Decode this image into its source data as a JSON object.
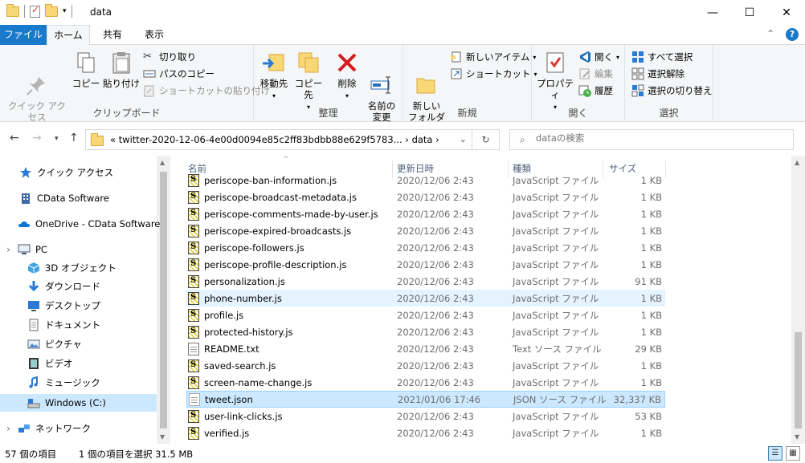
{
  "window": {
    "title": "data",
    "controls": [
      "—",
      "☐",
      "✕"
    ]
  },
  "tabs": {
    "file": "ファイル",
    "home": "ホーム",
    "share": "共有",
    "view": "表示"
  },
  "ribbon": {
    "clipboard": {
      "label": "クリップボード",
      "pin": "クイック アクセス\nにピン留めする",
      "copy": "コピー",
      "paste": "貼り付け",
      "cut": "切り取り",
      "copy_path": "パスのコピー",
      "paste_shortcut": "ショートカットの貼り付け"
    },
    "organize": {
      "label": "整理",
      "move_to": "移動先",
      "copy_to": "コピー先",
      "delete": "削除",
      "rename": "名前の\n変更"
    },
    "new": {
      "label": "新規",
      "new_folder": "新しい\nフォルダー",
      "new_item": "新しいアイテム",
      "shortcut": "ショートカット"
    },
    "open": {
      "label": "開く",
      "properties": "プロパティ",
      "open": "開く",
      "edit": "編集",
      "history": "履歴"
    },
    "select": {
      "label": "選択",
      "select_all": "すべて選択",
      "select_none": "選択解除",
      "invert": "選択の切り替え"
    }
  },
  "address": {
    "path": "«  twitter-2020-12-06-4e00d0094e85c2ff83bdbb88e629f5783...  ›  data  ›",
    "search_placeholder": "dataの検索"
  },
  "nav": {
    "items": [
      {
        "label": "クイック アクセス",
        "icon": "star-icon"
      },
      {
        "label": "CData Software",
        "icon": "building-icon"
      },
      {
        "label": "OneDrive - CData Software",
        "icon": "cloud-icon"
      },
      {
        "label": "PC",
        "icon": "pc-icon"
      },
      {
        "label": "3D オブジェクト",
        "icon": "cube-icon"
      },
      {
        "label": "ダウンロード",
        "icon": "download-icon"
      },
      {
        "label": "デスクトップ",
        "icon": "desktop-icon"
      },
      {
        "label": "ドキュメント",
        "icon": "document-icon"
      },
      {
        "label": "ピクチャ",
        "icon": "picture-icon"
      },
      {
        "label": "ビデオ",
        "icon": "video-icon"
      },
      {
        "label": "ミュージック",
        "icon": "music-icon"
      },
      {
        "label": "Windows (C:)",
        "icon": "drive-icon"
      },
      {
        "label": "ネットワーク",
        "icon": "network-icon"
      }
    ]
  },
  "columns": {
    "name": "名前",
    "date": "更新日時",
    "type": "種類",
    "size": "サイズ"
  },
  "files": [
    {
      "name": "periscope-ban-information.js",
      "date": "2020/12/06 2:43",
      "type": "JavaScript ファイル",
      "size": "1 KB",
      "kind": "js"
    },
    {
      "name": "periscope-broadcast-metadata.js",
      "date": "2020/12/06 2:43",
      "type": "JavaScript ファイル",
      "size": "1 KB",
      "kind": "js"
    },
    {
      "name": "periscope-comments-made-by-user.js",
      "date": "2020/12/06 2:43",
      "type": "JavaScript ファイル",
      "size": "1 KB",
      "kind": "js"
    },
    {
      "name": "periscope-expired-broadcasts.js",
      "date": "2020/12/06 2:43",
      "type": "JavaScript ファイル",
      "size": "1 KB",
      "kind": "js"
    },
    {
      "name": "periscope-followers.js",
      "date": "2020/12/06 2:43",
      "type": "JavaScript ファイル",
      "size": "1 KB",
      "kind": "js"
    },
    {
      "name": "periscope-profile-description.js",
      "date": "2020/12/06 2:43",
      "type": "JavaScript ファイル",
      "size": "1 KB",
      "kind": "js"
    },
    {
      "name": "personalization.js",
      "date": "2020/12/06 2:43",
      "type": "JavaScript ファイル",
      "size": "91 KB",
      "kind": "js"
    },
    {
      "name": "phone-number.js",
      "date": "2020/12/06 2:43",
      "type": "JavaScript ファイル",
      "size": "1 KB",
      "kind": "js"
    },
    {
      "name": "profile.js",
      "date": "2020/12/06 2:43",
      "type": "JavaScript ファイル",
      "size": "1 KB",
      "kind": "js"
    },
    {
      "name": "protected-history.js",
      "date": "2020/12/06 2:43",
      "type": "JavaScript ファイル",
      "size": "1 KB",
      "kind": "js"
    },
    {
      "name": "README.txt",
      "date": "2020/12/06 2:43",
      "type": "Text ソース ファイル",
      "size": "29 KB",
      "kind": "txt"
    },
    {
      "name": "saved-search.js",
      "date": "2020/12/06 2:43",
      "type": "JavaScript ファイル",
      "size": "1 KB",
      "kind": "js"
    },
    {
      "name": "screen-name-change.js",
      "date": "2020/12/06 2:43",
      "type": "JavaScript ファイル",
      "size": "1 KB",
      "kind": "js"
    },
    {
      "name": "tweet.json",
      "date": "2021/01/06 17:46",
      "type": "JSON ソース ファイル",
      "size": "32,337 KB",
      "kind": "json"
    },
    {
      "name": "user-link-clicks.js",
      "date": "2020/12/06 2:43",
      "type": "JavaScript ファイル",
      "size": "53 KB",
      "kind": "js"
    },
    {
      "name": "verified.js",
      "date": "2020/12/06 2:43",
      "type": "JavaScript ファイル",
      "size": "1 KB",
      "kind": "js"
    }
  ],
  "status": {
    "count": "57 個の項目",
    "selected": "1 個の項目を選択  31.5 MB"
  }
}
